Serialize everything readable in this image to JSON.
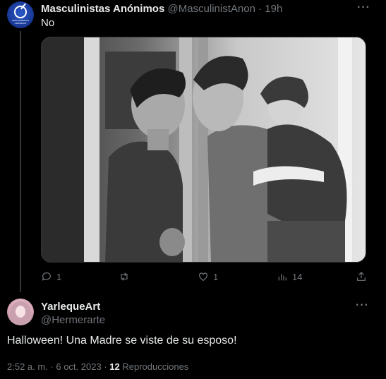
{
  "original_tweet": {
    "author_name": "Masculinistas Anónimos",
    "author_handle": "@MasculinistAnon",
    "separator": "·",
    "time": "19h",
    "text": "No",
    "avatar_text": "MASCULINISTAS ANÓNIMOS",
    "actions": {
      "replies": "1",
      "retweets": "",
      "likes": "1",
      "views": "14"
    }
  },
  "reply_tweet": {
    "author_name": "YarlequeArt",
    "author_handle": "@Hermerarte",
    "text": "Halloween! Una Madre se viste de su esposo!",
    "timestamp": "2:52 a. m. · 6 oct. 2023 ·",
    "views_count": "12",
    "views_label": "Reproducciones"
  },
  "icons": [
    "more-icon",
    "reply-icon",
    "retweet-icon",
    "like-icon",
    "views-icon",
    "share-icon"
  ],
  "colors": {
    "background": "#000000",
    "text": "#e7e9ea",
    "muted": "#71767b",
    "divider": "#2f3336"
  }
}
